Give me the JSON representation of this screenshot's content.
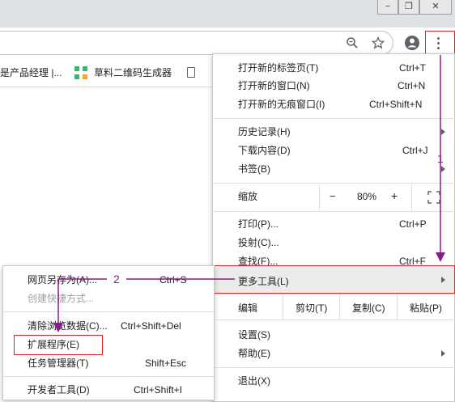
{
  "window": {
    "minimize_label": "−",
    "restore_label": "❐",
    "close_label": "✕"
  },
  "toolbar": {
    "zoom_icon": "zoom-icon",
    "bookmark_star_icon": "star-icon",
    "profile_icon": "profile-icon",
    "menu_icon": "kebab-menu-icon"
  },
  "bookmarks": [
    {
      "label": "是产品经理 |..."
    },
    {
      "label": "草料二维码生成器"
    }
  ],
  "main_menu": {
    "new_tab": {
      "label": "打开新的标签页(T)",
      "shortcut": "Ctrl+T"
    },
    "new_window": {
      "label": "打开新的窗口(N)",
      "shortcut": "Ctrl+N"
    },
    "new_incognito": {
      "label": "打开新的无痕窗口(I)",
      "shortcut": "Ctrl+Shift+N"
    },
    "history": {
      "label": "历史记录(H)"
    },
    "downloads": {
      "label": "下载内容(D)",
      "shortcut": "Ctrl+J"
    },
    "bookmarks": {
      "label": "书签(B)"
    },
    "zoom": {
      "label": "缩放",
      "minus": "−",
      "value": "80%",
      "plus": "+"
    },
    "print": {
      "label": "打印(P)...",
      "shortcut": "Ctrl+P"
    },
    "cast": {
      "label": "投射(C)..."
    },
    "find": {
      "label": "查找(F)...",
      "shortcut": "Ctrl+F"
    },
    "more_tools": {
      "label": "更多工具(L)"
    },
    "edit": {
      "label": "编辑",
      "cut": "剪切(T)",
      "copy": "复制(C)",
      "paste": "粘贴(P)"
    },
    "settings": {
      "label": "设置(S)"
    },
    "help": {
      "label": "帮助(E)"
    },
    "exit": {
      "label": "退出(X)"
    }
  },
  "submenu": {
    "save_page": {
      "label": "网页另存为(A)...",
      "shortcut": "Ctrl+S"
    },
    "create_shortcut": {
      "label": "创建快捷方式..."
    },
    "clear_data": {
      "label": "清除浏览数据(C)...",
      "shortcut": "Ctrl+Shift+Del"
    },
    "extensions": {
      "label": "扩展程序(E)"
    },
    "task_manager": {
      "label": "任务管理器(T)",
      "shortcut": "Shift+Esc"
    },
    "dev_tools": {
      "label": "开发者工具(D)",
      "shortcut": "Ctrl+Shift+I"
    }
  },
  "annotations": {
    "step1": "1",
    "step2": "2",
    "highlight_color": "#e0252b",
    "arrow_color": "#8b1a8b"
  }
}
